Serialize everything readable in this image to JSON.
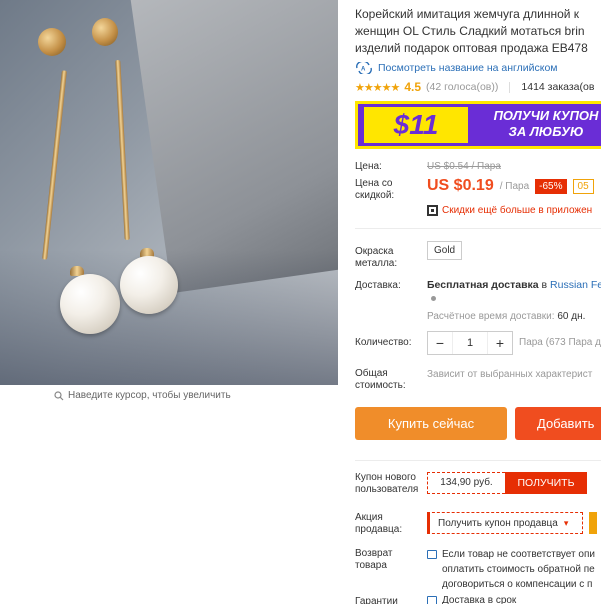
{
  "zoom_hint": "Наведите курсор, чтобы увеличить",
  "title_lines": [
    "Корейский имитация жемчуга длинной к",
    "женщин OL Стиль Сладкий мотаться brin",
    "изделий подарок оптовая продажа EB478"
  ],
  "translate_link": "Посмотреть название на английском",
  "translate_icon": "translate-icon",
  "rating": {
    "stars": "★★★★★",
    "value": "4.5",
    "reviews": "(42 голоса(ов))",
    "orders": "1414 заказа(ов"
  },
  "banner": {
    "amount": "$11",
    "text_line1": "ПОЛУЧИ КУПОН",
    "text_line2": "ЗА ЛЮБУЮ",
    "bg_color": "#6a2dd6",
    "accent_color": "#ffe600"
  },
  "price": {
    "label": "Цена:",
    "old": "US $0.54 / Пара",
    "discount_label": "Цена со скидкой:",
    "new": "US $0.19",
    "unit": "/ Пара",
    "discount": "-65%",
    "discount2": "05",
    "app_promo": "Скидки ещё больше в приложен",
    "price_color": "#f04d1f"
  },
  "color": {
    "label": "Окраска металла:",
    "option": "Gold"
  },
  "shipping": {
    "label": "Доставка:",
    "text": "Бесплатная доставка",
    "prep": " в ",
    "dest": "Russian Fe",
    "time_label": "Расчётное время доставки:",
    "time_value": "60 дн."
  },
  "quantity": {
    "label": "Количество:",
    "minus": "−",
    "value": "1",
    "plus": "+",
    "available": "Пара (673 Пара д"
  },
  "total": {
    "label": "Общая стоимость:",
    "value": "Зависит от выбранных характерист"
  },
  "actions": {
    "buy_now": "Купить сейчас",
    "add_cart": "Добавить"
  },
  "coupon": {
    "label": "Купон нового пользователя",
    "amount": "134,90 руб.",
    "button": "ПОЛУЧИТЬ"
  },
  "seller_coupon": {
    "label": "Акция продавца:",
    "button": "Получить купон продавца",
    "chevron": "▾"
  },
  "returns": {
    "label": "Возврат товара",
    "lines": [
      "Если товар не соответствует опи",
      "оплатить стоимость обратной пе",
      "договориться о компенсации с п"
    ]
  },
  "guarantee": {
    "label": "Гарантии",
    "text": "Доставка в срок"
  }
}
